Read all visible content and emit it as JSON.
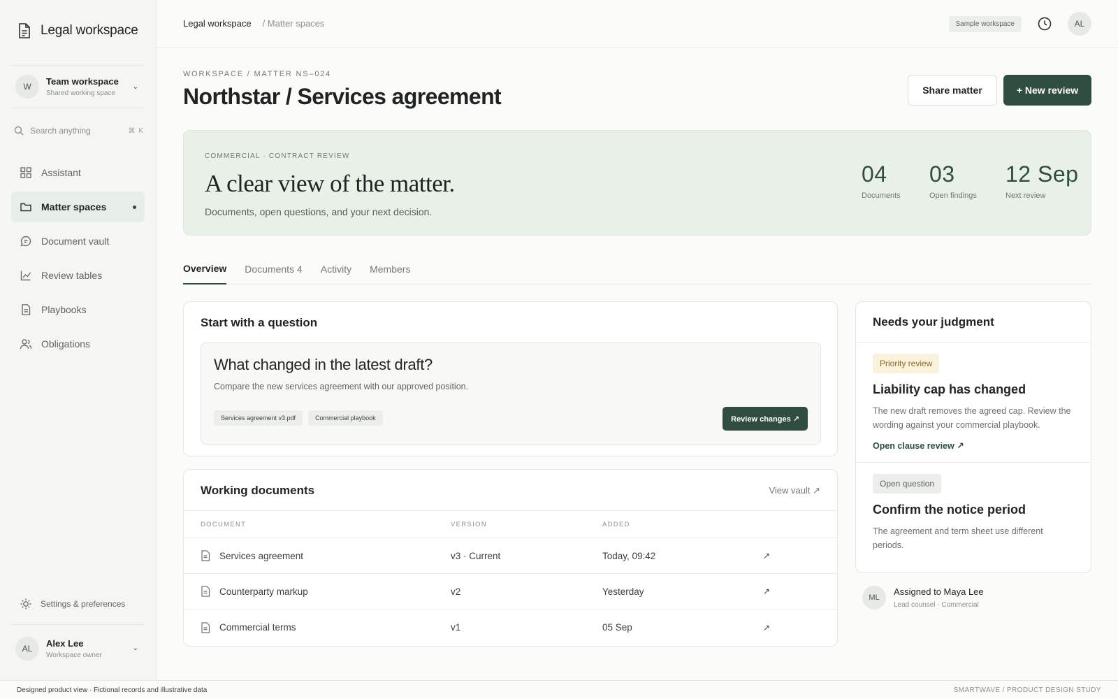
{
  "brand": {
    "title": "Legal workspace",
    "icon": "document-icon"
  },
  "workspace": {
    "avatar": "W",
    "name": "Team workspace",
    "subtitle": "Shared working space"
  },
  "search": {
    "placeholder": "Search anything",
    "shortcut": "⌘ K"
  },
  "sidebar": {
    "items": [
      {
        "label": "Assistant",
        "icon": "grid-icon",
        "active": false
      },
      {
        "label": "Matter spaces",
        "icon": "folder-icon",
        "active": true
      },
      {
        "label": "Document vault",
        "icon": "chat-bubble-icon",
        "active": false
      },
      {
        "label": "Review tables",
        "icon": "line-chart-icon",
        "active": false
      },
      {
        "label": "Playbooks",
        "icon": "file-icon",
        "active": false
      },
      {
        "label": "Obligations",
        "icon": "users-icon",
        "active": false
      }
    ],
    "settings": "Settings & preferences"
  },
  "user": {
    "initials": "AL",
    "name": "Alex Lee",
    "role": "Workspace owner"
  },
  "topbar": {
    "crumb_root": "Legal workspace",
    "crumb_current": "/ Matter spaces",
    "badge": "Sample workspace",
    "avatar": "AL"
  },
  "page": {
    "eyebrow": "WORKSPACE / MATTER NS–024",
    "title": "Northstar / Services agreement",
    "share_label": "Share matter",
    "new_review_label": "+ New review"
  },
  "hero": {
    "eyebrow": "COMMERCIAL · CONTRACT REVIEW",
    "title": "A clear view of the matter.",
    "subtitle": "Documents, open questions, and your next decision.",
    "stats": [
      {
        "value": "04",
        "label": "Documents"
      },
      {
        "value": "03",
        "label": "Open findings"
      },
      {
        "value": "12 Sep",
        "label": "Next review"
      }
    ]
  },
  "tabs": [
    "Overview",
    "Documents 4",
    "Activity",
    "Members"
  ],
  "question": {
    "card_title": "Start with a question",
    "title": "What changed in the latest draft?",
    "subtitle": "Compare the new services agreement with our approved position.",
    "chips": [
      "Services agreement v3.pdf",
      "Commercial playbook"
    ],
    "button": "Review changes ↗"
  },
  "documents": {
    "card_title": "Working documents",
    "view_vault": "View vault ↗",
    "headers": [
      "DOCUMENT",
      "VERSION",
      "ADDED"
    ],
    "rows": [
      {
        "name": "Services agreement",
        "version": "v3 · Current",
        "added": "Today, 09:42",
        "open": "↗"
      },
      {
        "name": "Counterparty markup",
        "version": "v2",
        "added": "Yesterday",
        "open": "↗"
      },
      {
        "name": "Commercial terms",
        "version": "v1",
        "added": "05 Sep",
        "open": "↗"
      }
    ]
  },
  "judgment": {
    "card_title": "Needs your judgment",
    "items": [
      {
        "tag": "Priority review",
        "title": "Liability cap has changed",
        "text": "The new draft removes the agreed cap. Review the wording against your commercial playbook.",
        "link": "Open clause review ↗"
      },
      {
        "tag": "Open question",
        "title": "Confirm the notice period",
        "text": "The agreement and term sheet use different periods."
      }
    ]
  },
  "assignee": {
    "initials": "ML",
    "name": "Assigned to Maya Lee",
    "role": "Lead counsel · Commercial"
  },
  "footer": {
    "left": "Designed product view · Fictional records and illustrative data",
    "right": "SMARTWAVE / PRODUCT DESIGN STUDY"
  },
  "colors": {
    "accent": "#2f4e40",
    "hero_bg": "#e9f0e8",
    "warn_bg": "#fbf2de"
  }
}
